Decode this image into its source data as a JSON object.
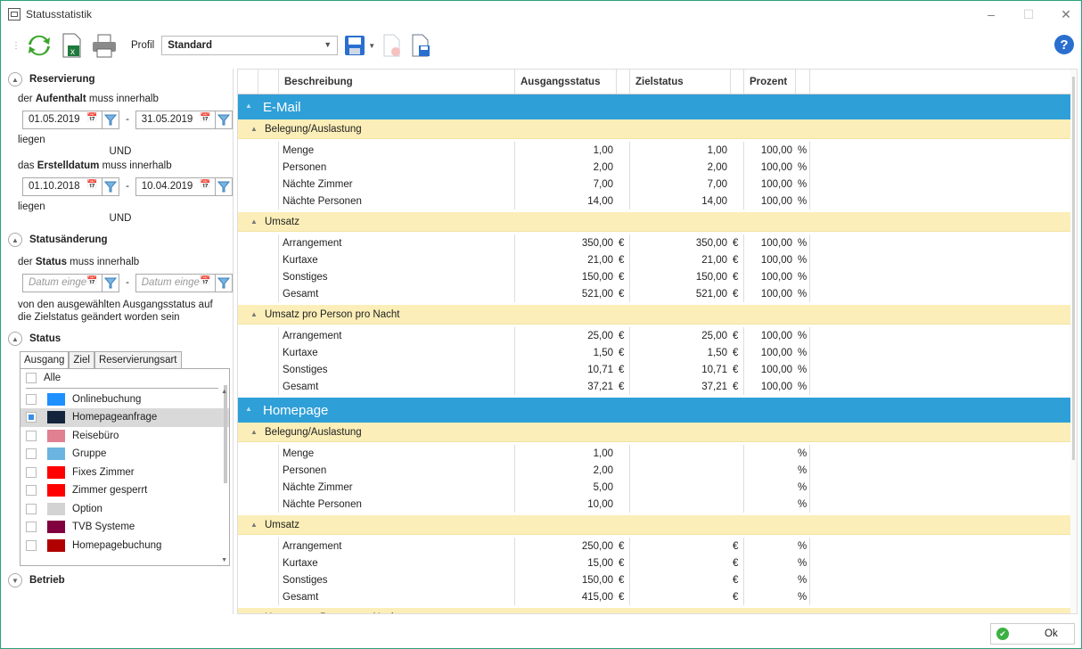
{
  "window": {
    "title": "Statusstatistik"
  },
  "toolbar": {
    "profil_label": "Profil",
    "profil_value": "Standard"
  },
  "left": {
    "reservierung": {
      "header": "Reservierung",
      "aufenthalt_pre": "der ",
      "aufenthalt_bold": "Aufenthalt",
      "aufenthalt_post": " muss innerhalb",
      "from1": "01.05.2019",
      "to1": "31.05.2019",
      "liegen1": "liegen",
      "und1": "UND",
      "erstell_pre": "das ",
      "erstell_bold": "Erstelldatum",
      "erstell_post": " muss innerhalb",
      "from2": "01.10.2018",
      "to2": "10.04.2019",
      "liegen2": "liegen",
      "und2": "UND"
    },
    "statusaenderung": {
      "header": "Statusänderung",
      "status_pre": "der ",
      "status_bold": "Status",
      "status_post": " muss innerhalb",
      "from_placeholder": "Datum einge",
      "to_placeholder": "Datum einge",
      "note": "von den ausgewählten Ausgangsstatus auf die Zielstatus geändert worden sein"
    },
    "status": {
      "header": "Status",
      "tabs": [
        "Ausgang",
        "Ziel",
        "Reservierungsart"
      ],
      "alle": "Alle",
      "items": [
        {
          "label": "Onlinebuchung",
          "color": "#1e90ff",
          "checked": false
        },
        {
          "label": "Homepageanfrage",
          "color": "#14243c",
          "checked": true
        },
        {
          "label": "Reisebüro",
          "color": "#e08090",
          "checked": false
        },
        {
          "label": "Gruppe",
          "color": "#6bb3e0",
          "checked": false
        },
        {
          "label": "Fixes Zimmer",
          "color": "#ff0000",
          "checked": false
        },
        {
          "label": "Zimmer gesperrt",
          "color": "#ff0000",
          "checked": false
        },
        {
          "label": "Option",
          "color": "#d3d3d3",
          "checked": false
        },
        {
          "label": "TVB Systeme",
          "color": "#800040",
          "checked": false
        },
        {
          "label": "Homepagebuchung",
          "color": "#b00000",
          "checked": false
        }
      ]
    },
    "betrieb": {
      "header": "Betrieb"
    }
  },
  "grid": {
    "headers": {
      "beschreibung": "Beschreibung",
      "ausgang": "Ausgangsstatus",
      "ziel": "Zielstatus",
      "prozent": "Prozent"
    },
    "groups": [
      {
        "name": "E-Mail",
        "subs": [
          {
            "name": "Belegung/Auslastung",
            "rows": [
              {
                "label": "Menge",
                "a": "1,00",
                "au": "",
                "z": "1,00",
                "zu": "",
                "p": "100,00",
                "pu": "%"
              },
              {
                "label": "Personen",
                "a": "2,00",
                "au": "",
                "z": "2,00",
                "zu": "",
                "p": "100,00",
                "pu": "%"
              },
              {
                "label": "Nächte Zimmer",
                "a": "7,00",
                "au": "",
                "z": "7,00",
                "zu": "",
                "p": "100,00",
                "pu": "%"
              },
              {
                "label": "Nächte Personen",
                "a": "14,00",
                "au": "",
                "z": "14,00",
                "zu": "",
                "p": "100,00",
                "pu": "%"
              }
            ]
          },
          {
            "name": "Umsatz",
            "rows": [
              {
                "label": "Arrangement",
                "a": "350,00",
                "au": "€",
                "z": "350,00",
                "zu": "€",
                "p": "100,00",
                "pu": "%"
              },
              {
                "label": "Kurtaxe",
                "a": "21,00",
                "au": "€",
                "z": "21,00",
                "zu": "€",
                "p": "100,00",
                "pu": "%"
              },
              {
                "label": "Sonstiges",
                "a": "150,00",
                "au": "€",
                "z": "150,00",
                "zu": "€",
                "p": "100,00",
                "pu": "%"
              },
              {
                "label": "Gesamt",
                "a": "521,00",
                "au": "€",
                "z": "521,00",
                "zu": "€",
                "p": "100,00",
                "pu": "%"
              }
            ]
          },
          {
            "name": "Umsatz pro Person pro Nacht",
            "rows": [
              {
                "label": "Arrangement",
                "a": "25,00",
                "au": "€",
                "z": "25,00",
                "zu": "€",
                "p": "100,00",
                "pu": "%"
              },
              {
                "label": "Kurtaxe",
                "a": "1,50",
                "au": "€",
                "z": "1,50",
                "zu": "€",
                "p": "100,00",
                "pu": "%"
              },
              {
                "label": "Sonstiges",
                "a": "10,71",
                "au": "€",
                "z": "10,71",
                "zu": "€",
                "p": "100,00",
                "pu": "%"
              },
              {
                "label": "Gesamt",
                "a": "37,21",
                "au": "€",
                "z": "37,21",
                "zu": "€",
                "p": "100,00",
                "pu": "%"
              }
            ]
          }
        ]
      },
      {
        "name": "Homepage",
        "subs": [
          {
            "name": "Belegung/Auslastung",
            "rows": [
              {
                "label": "Menge",
                "a": "1,00",
                "au": "",
                "z": "",
                "zu": "",
                "p": "",
                "pu": "%"
              },
              {
                "label": "Personen",
                "a": "2,00",
                "au": "",
                "z": "",
                "zu": "",
                "p": "",
                "pu": "%"
              },
              {
                "label": "Nächte Zimmer",
                "a": "5,00",
                "au": "",
                "z": "",
                "zu": "",
                "p": "",
                "pu": "%"
              },
              {
                "label": "Nächte Personen",
                "a": "10,00",
                "au": "",
                "z": "",
                "zu": "",
                "p": "",
                "pu": "%"
              }
            ]
          },
          {
            "name": "Umsatz",
            "rows": [
              {
                "label": "Arrangement",
                "a": "250,00",
                "au": "€",
                "z": "",
                "zu": "€",
                "p": "",
                "pu": "%"
              },
              {
                "label": "Kurtaxe",
                "a": "15,00",
                "au": "€",
                "z": "",
                "zu": "€",
                "p": "",
                "pu": "%"
              },
              {
                "label": "Sonstiges",
                "a": "150,00",
                "au": "€",
                "z": "",
                "zu": "€",
                "p": "",
                "pu": "%"
              },
              {
                "label": "Gesamt",
                "a": "415,00",
                "au": "€",
                "z": "",
                "zu": "€",
                "p": "",
                "pu": "%"
              }
            ]
          },
          {
            "name": "Umsatz pro Person pro Nacht",
            "rows": []
          }
        ]
      }
    ]
  },
  "footer": {
    "ok_label": "Ok"
  }
}
